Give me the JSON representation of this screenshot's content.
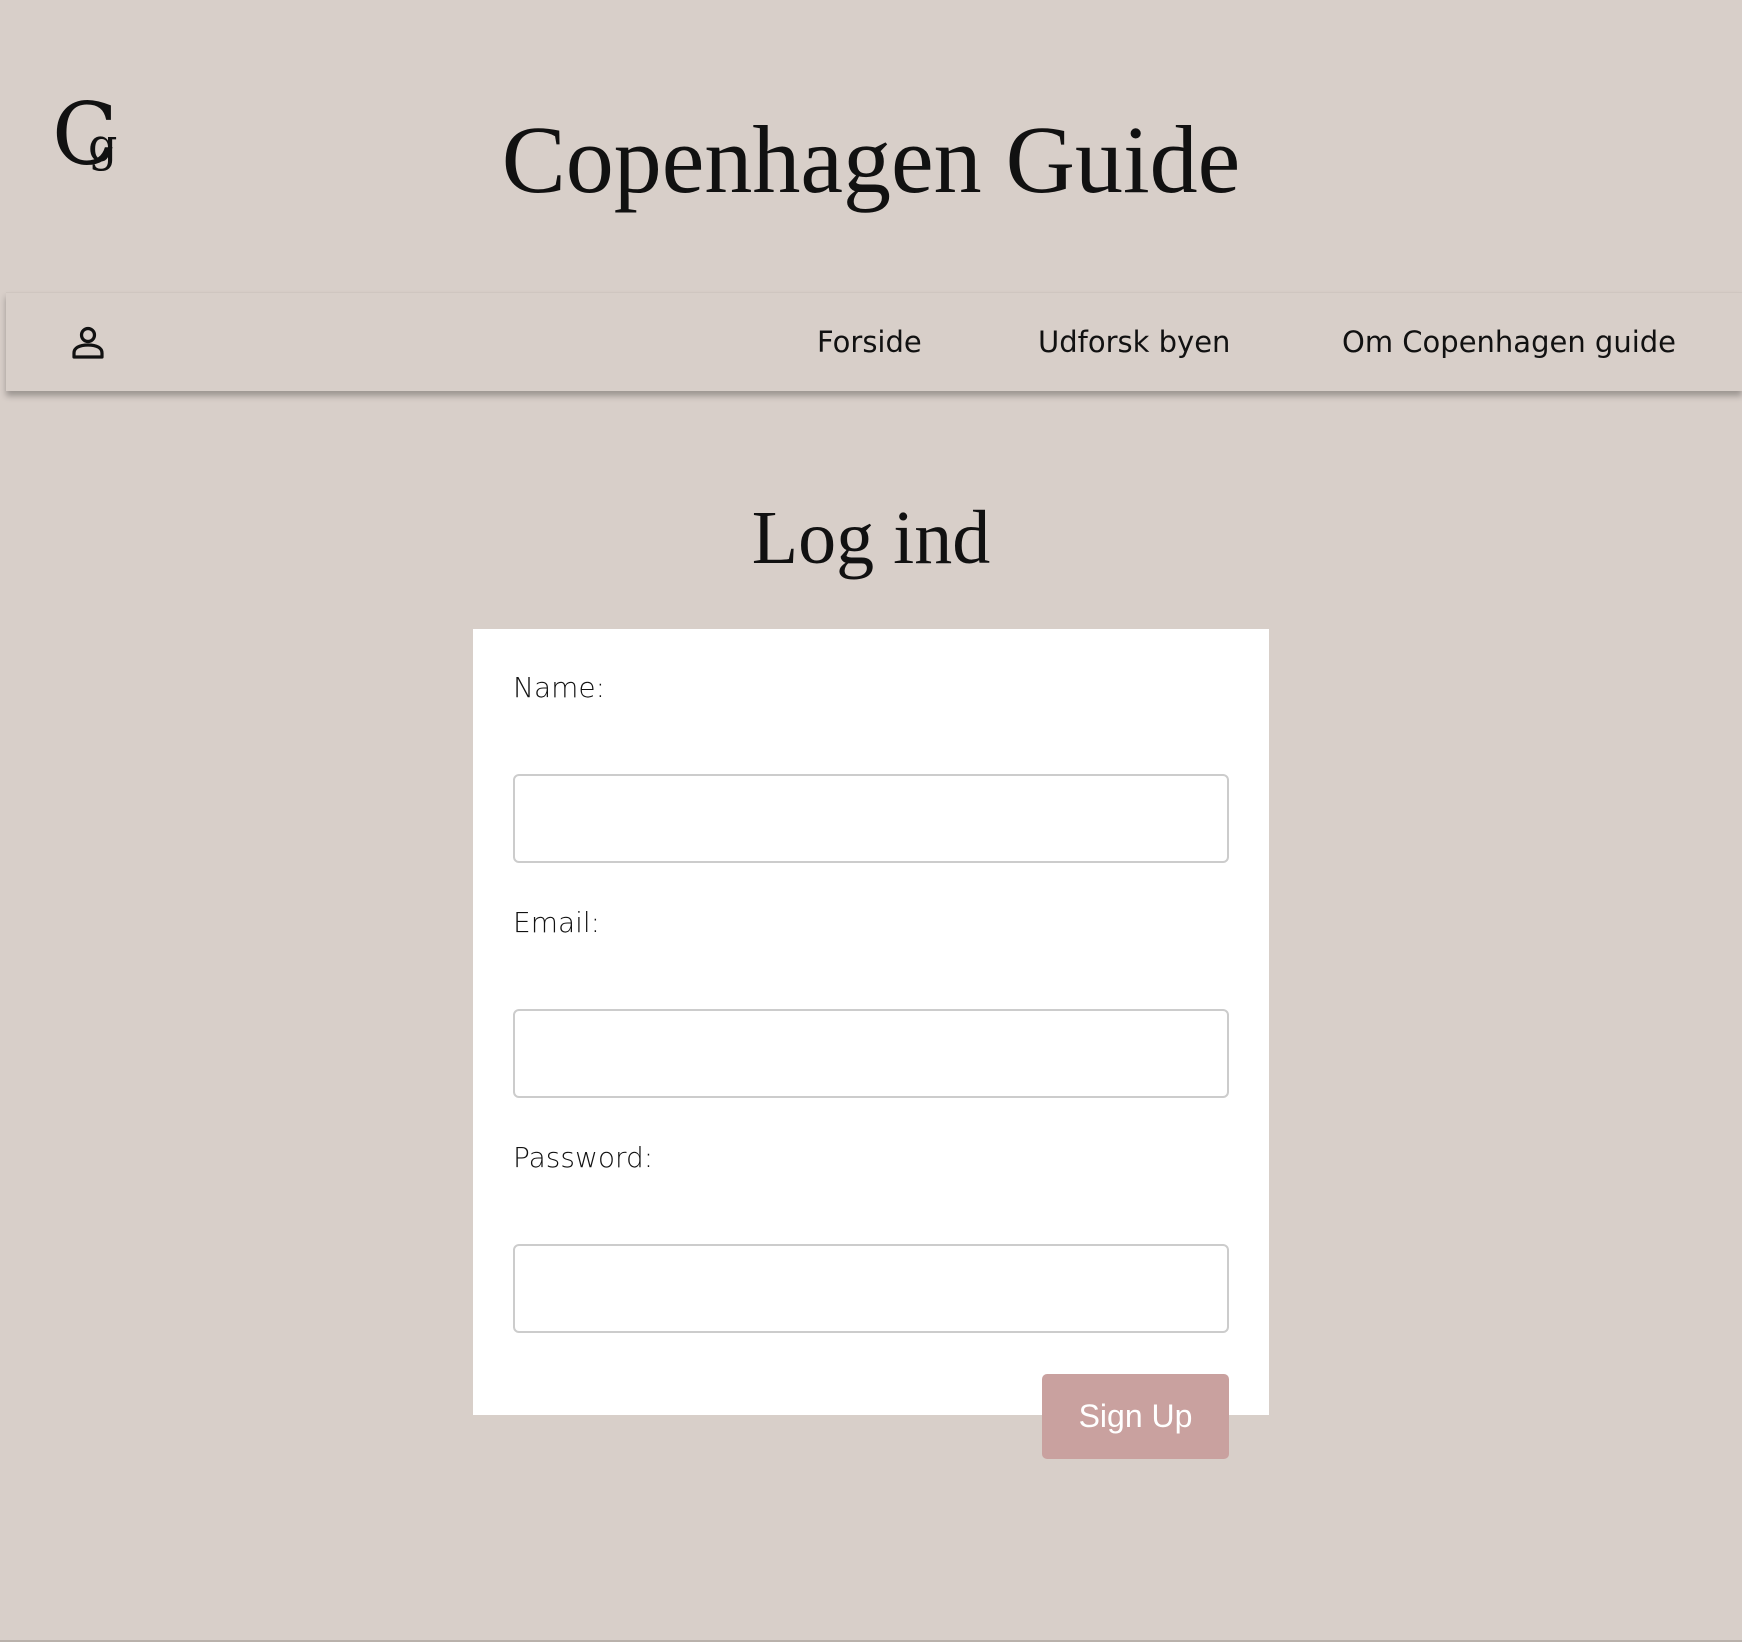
{
  "header": {
    "logo_text": "Cg",
    "title": "Copenhagen Guide"
  },
  "nav": {
    "user_icon": "user-icon",
    "links": [
      {
        "label": "Forside"
      },
      {
        "label": "Udforsk byen"
      },
      {
        "label": "Om Copenhagen guide"
      }
    ]
  },
  "main": {
    "heading": "Log ind",
    "form": {
      "name_label": "Name:",
      "name_value": "",
      "email_label": "Email:",
      "email_value": "",
      "password_label": "Password:",
      "password_value": "",
      "submit_label": "Sign Up"
    }
  },
  "colors": {
    "background": "#d8cfc9",
    "card": "#ffffff",
    "button": "#c9a19f",
    "button_text": "#ffffff",
    "text": "#111111"
  }
}
